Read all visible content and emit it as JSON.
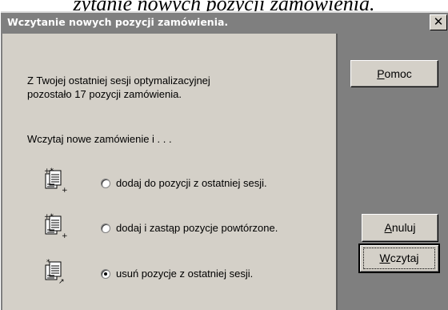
{
  "background_title": "zytanie nowych pozycji zamówienia.",
  "dialog": {
    "title": "Wczytanie nowych pozycji zamówienia.",
    "close_glyph": "✕"
  },
  "info": {
    "line1": "Z Twojej ostatniej sesji optymalizacyjnej",
    "line2": "pozostało 17 pozycji zamówienia."
  },
  "prompt": "Wczytaj nowe zamówienie i . . .",
  "options": [
    {
      "label": "dodaj do pozycji z ostatniej sesji.",
      "selected": false,
      "icon": "add-document-icon"
    },
    {
      "label": "dodaj i zastąp pozycje powtórzone.",
      "selected": false,
      "icon": "replace-document-icon"
    },
    {
      "label": "usuń pozycje z ostatniej sesji.",
      "selected": true,
      "icon": "remove-document-icon"
    }
  ],
  "buttons": {
    "help": {
      "mnemonic": "P",
      "rest": "omoc"
    },
    "cancel": {
      "mnemonic": "A",
      "rest": "nuluj"
    },
    "load": {
      "mnemonic": "W",
      "rest": "czytaj"
    }
  },
  "colors": {
    "face": "#d4d0c8",
    "frame": "#7f7f7f",
    "title_text": "#ffffff"
  }
}
